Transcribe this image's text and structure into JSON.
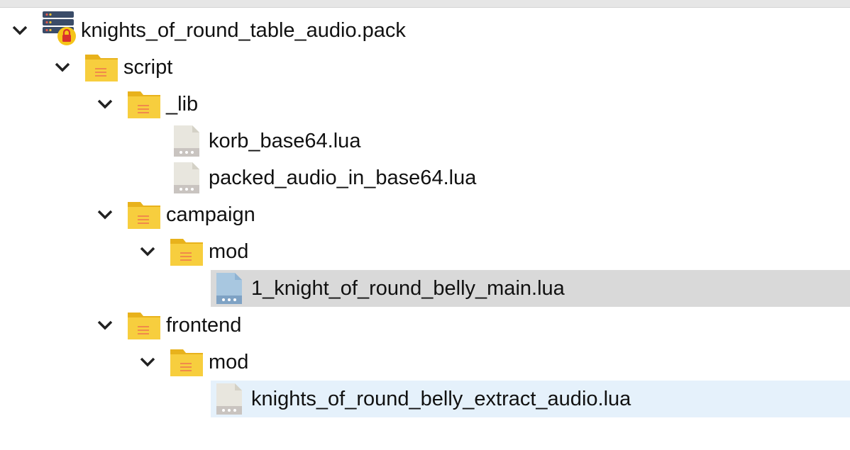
{
  "tree": {
    "root": {
      "label": "knights_of_round_table_audio.pack",
      "icon": "locked-pack-icon",
      "expanded": true
    },
    "script": {
      "label": "script",
      "icon": "folder-icon",
      "expanded": true
    },
    "lib": {
      "label": "_lib",
      "icon": "folder-icon",
      "expanded": true
    },
    "korb": {
      "label": "korb_base64.lua",
      "icon": "file-icon"
    },
    "packed": {
      "label": "packed_audio_in_base64.lua",
      "icon": "file-icon"
    },
    "campaign": {
      "label": "campaign",
      "icon": "folder-icon",
      "expanded": true
    },
    "campaign_mod": {
      "label": "mod",
      "icon": "folder-icon",
      "expanded": true
    },
    "belly_main": {
      "label": "1_knight_of_round_belly_main.lua",
      "icon": "file-icon-blue",
      "state": "selected"
    },
    "frontend": {
      "label": "frontend",
      "icon": "folder-icon",
      "expanded": true
    },
    "frontend_mod": {
      "label": "mod",
      "icon": "folder-icon",
      "expanded": true
    },
    "extract": {
      "label": "knights_of_round_belly_extract_audio.lua",
      "icon": "file-icon",
      "state": "hover"
    }
  },
  "colors": {
    "selected_row": "#d9d9d9",
    "hover_row": "#e5f1fb",
    "folder": "#f5c518",
    "folder_lines": "#f08a4b",
    "file": "#e8e6de",
    "file_blue": "#a8c7e0"
  }
}
